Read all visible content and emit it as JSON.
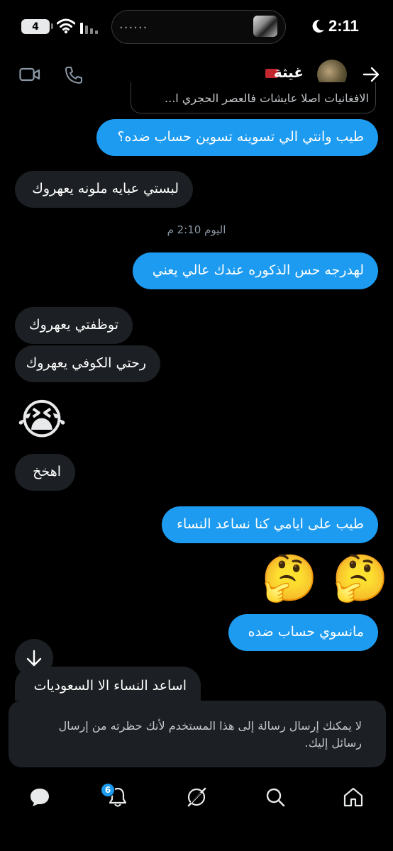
{
  "status_bar": {
    "battery_level": "4",
    "time": "2:11",
    "island_text": "......"
  },
  "header": {
    "contact_name": "غيثة",
    "quoted_preview": "الافغانيات اصلا عايشات فالعصر الحجري ا..."
  },
  "messages": [
    {
      "side": "sent",
      "text": "طيب وانتي الي تسوينه تسوين حساب ضده؟"
    },
    {
      "side": "received",
      "text": "لبستي عبايه ملونه يعهروك"
    },
    {
      "side": "sent",
      "text": "لهدرجه حس الذكوره عندك عالي يعني"
    },
    {
      "side": "received",
      "text": "توظفتي يعهروك"
    },
    {
      "side": "received",
      "text": "رحتي الكوفي يعهروك"
    },
    {
      "side": "received",
      "text": "😭"
    },
    {
      "side": "received",
      "text": "اهخخ"
    },
    {
      "side": "sent",
      "text": "طيب على ايامي كنا نساعد النساء"
    },
    {
      "side": "sent",
      "text": "🤔 🤔"
    },
    {
      "side": "sent",
      "text": "مانسوي حساب ضده"
    },
    {
      "side": "received",
      "text": "اساعد النساء الا السعوديات"
    }
  ],
  "timestamp": "اليوم 2:10 م",
  "blocked_notice": "لا يمكنك إرسال رسالة إلى هذا المستخدم لأنك حظرته من إرسال رسائل إليك.",
  "nav": {
    "notifications_badge": "6",
    "items": [
      "messages-icon",
      "notifications-icon",
      "grok-icon",
      "search-icon",
      "home-icon"
    ]
  },
  "colors": {
    "accent": "#1d9bf0",
    "received_bubble": "#1c1f23",
    "background": "#000000"
  }
}
